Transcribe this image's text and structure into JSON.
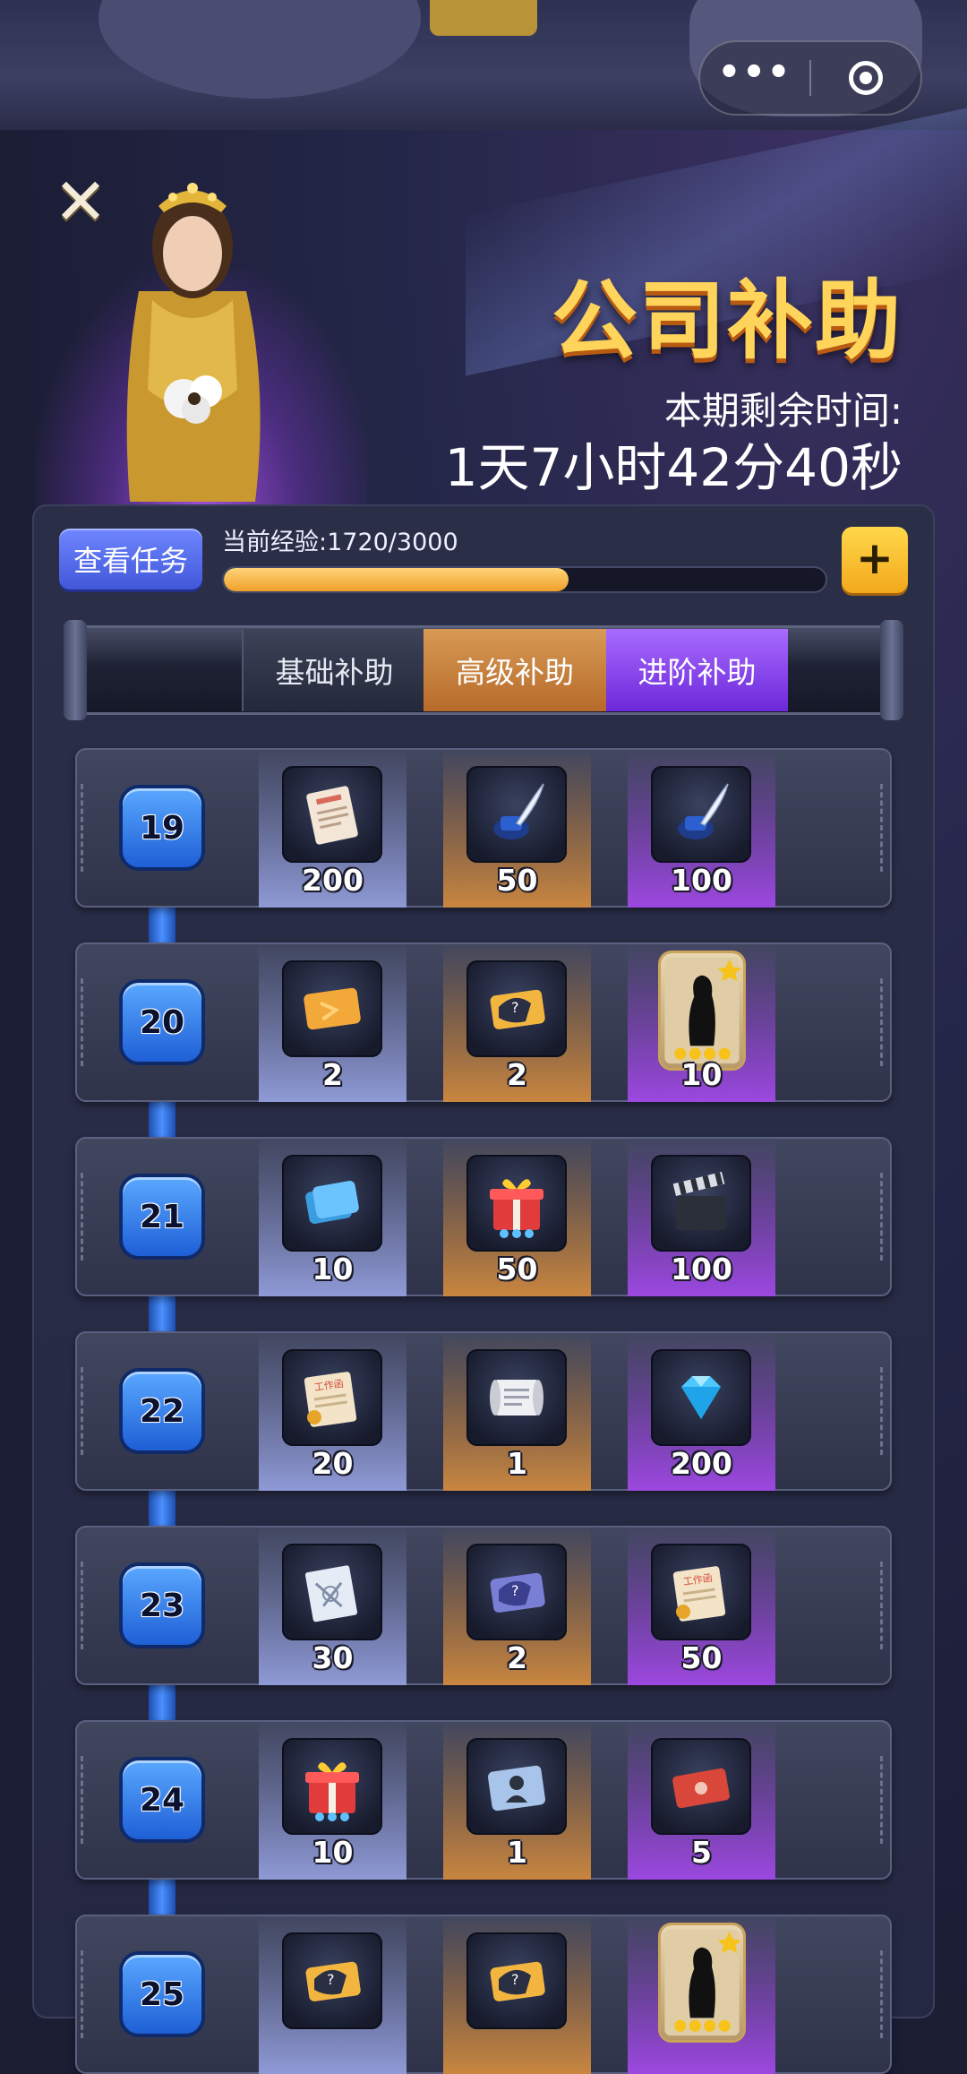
{
  "capsule": {
    "more_label": "•••"
  },
  "header": {
    "title": "公司补助",
    "remaining_label": "本期剩余时间:",
    "remaining_time": "1天7小时42分40秒"
  },
  "progress": {
    "task_button": "查看任务",
    "exp_label": "当前经验:1720/3000",
    "exp_current": 1720,
    "exp_total": 3000,
    "plus_label": "+"
  },
  "tabs": [
    {
      "label": "基础补助"
    },
    {
      "label": "高级补助"
    },
    {
      "label": "进阶补助"
    }
  ],
  "levels": [
    {
      "level": "19",
      "rewards": [
        {
          "icon": "contract-document-icon",
          "qty": "200"
        },
        {
          "icon": "ink-quill-icon",
          "qty": "50"
        },
        {
          "icon": "ink-quill-icon",
          "qty": "100"
        }
      ]
    },
    {
      "level": "20",
      "rewards": [
        {
          "icon": "orange-ticket-icon",
          "qty": "2"
        },
        {
          "icon": "mystery-ticket-icon",
          "qty": "2"
        },
        {
          "icon": "actor-card-icon",
          "qty": "10"
        }
      ]
    },
    {
      "level": "21",
      "rewards": [
        {
          "icon": "blue-cards-icon",
          "qty": "10"
        },
        {
          "icon": "gift-box-icon",
          "qty": "50"
        },
        {
          "icon": "clapperboard-icon",
          "qty": "100"
        }
      ]
    },
    {
      "level": "22",
      "rewards": [
        {
          "icon": "work-order-scroll-icon",
          "qty": "20"
        },
        {
          "icon": "paper-scroll-icon",
          "qty": "1"
        },
        {
          "icon": "diamond-icon",
          "qty": "200"
        }
      ]
    },
    {
      "level": "23",
      "rewards": [
        {
          "icon": "blueprint-icon",
          "qty": "30"
        },
        {
          "icon": "purple-mystery-ticket-icon",
          "qty": "2"
        },
        {
          "icon": "work-order-scroll-icon",
          "qty": "50"
        }
      ]
    },
    {
      "level": "24",
      "rewards": [
        {
          "icon": "gift-box-icon",
          "qty": "10"
        },
        {
          "icon": "portrait-card-icon",
          "qty": "1"
        },
        {
          "icon": "red-ticket-icon",
          "qty": "5"
        }
      ]
    },
    {
      "level": "25",
      "rewards": [
        {
          "icon": "mystery-ticket-icon",
          "qty": ""
        },
        {
          "icon": "mystery-ticket-icon",
          "qty": ""
        },
        {
          "icon": "actor-card-icon",
          "qty": ""
        }
      ]
    }
  ]
}
